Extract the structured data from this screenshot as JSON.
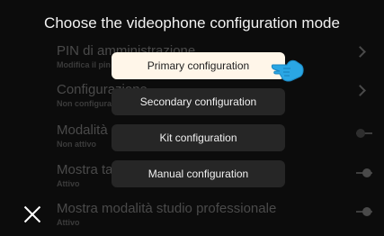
{
  "dialog": {
    "title": "Choose the videophone configuration mode",
    "options": [
      {
        "label": "Primary configuration",
        "selected": true
      },
      {
        "label": "Secondary configuration",
        "selected": false
      },
      {
        "label": "Kit configuration",
        "selected": false
      },
      {
        "label": "Manual configuration",
        "selected": false
      }
    ],
    "close_icon": "close-icon",
    "pointer_icon": "hand-pointer-icon"
  },
  "background_list": {
    "items": [
      {
        "title": "PIN di amministrazione",
        "subtitle": "Modifica il pin",
        "control": "chevron"
      },
      {
        "title": "Configurazione",
        "subtitle": "Non configurato",
        "control": "chevron"
      },
      {
        "title": "Modalità riposo",
        "subtitle": "Non attivo",
        "control": "toggle-off"
      },
      {
        "title": "Mostra tastiera",
        "subtitle": "Attivo",
        "control": "toggle-on"
      },
      {
        "title": "Mostra modalità studio professionale",
        "subtitle": "Attivo",
        "control": "toggle-on"
      }
    ]
  },
  "colors": {
    "selected_option_bg": "#fff6e9",
    "option_bg": "#262626",
    "pointer_blue": "#2aa6e4",
    "background": "#0c0c0c"
  }
}
